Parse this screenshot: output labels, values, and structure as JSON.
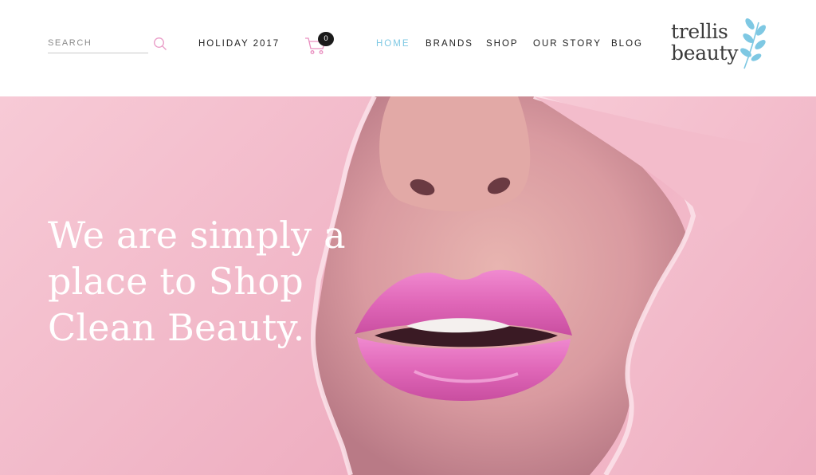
{
  "header": {
    "search": {
      "placeholder": "SEARCH",
      "value": ""
    },
    "holiday_label": "HOLIDAY 2017",
    "cart": {
      "count": "0"
    },
    "nav": [
      {
        "label": "HOME",
        "active": true
      },
      {
        "label": "BRANDS",
        "active": false
      },
      {
        "label": "SHOP",
        "active": false
      },
      {
        "label": "OUR STORY",
        "active": false
      },
      {
        "label": "BLOG",
        "active": false
      }
    ],
    "logo": {
      "line1": "trellis",
      "line2": "beauty",
      "icon": "leaf-branch-icon"
    }
  },
  "hero": {
    "headline": "We are simply a place to Shop Clean Beauty.",
    "image": "pink-lips-through-torn-paper"
  },
  "colors": {
    "accent_blue": "#7ec8e3",
    "nav_text": "#222222",
    "hero_pink": "#f1b5c6",
    "lip_pink": "#e36fb8",
    "cart_pink": "#e98fc0"
  }
}
